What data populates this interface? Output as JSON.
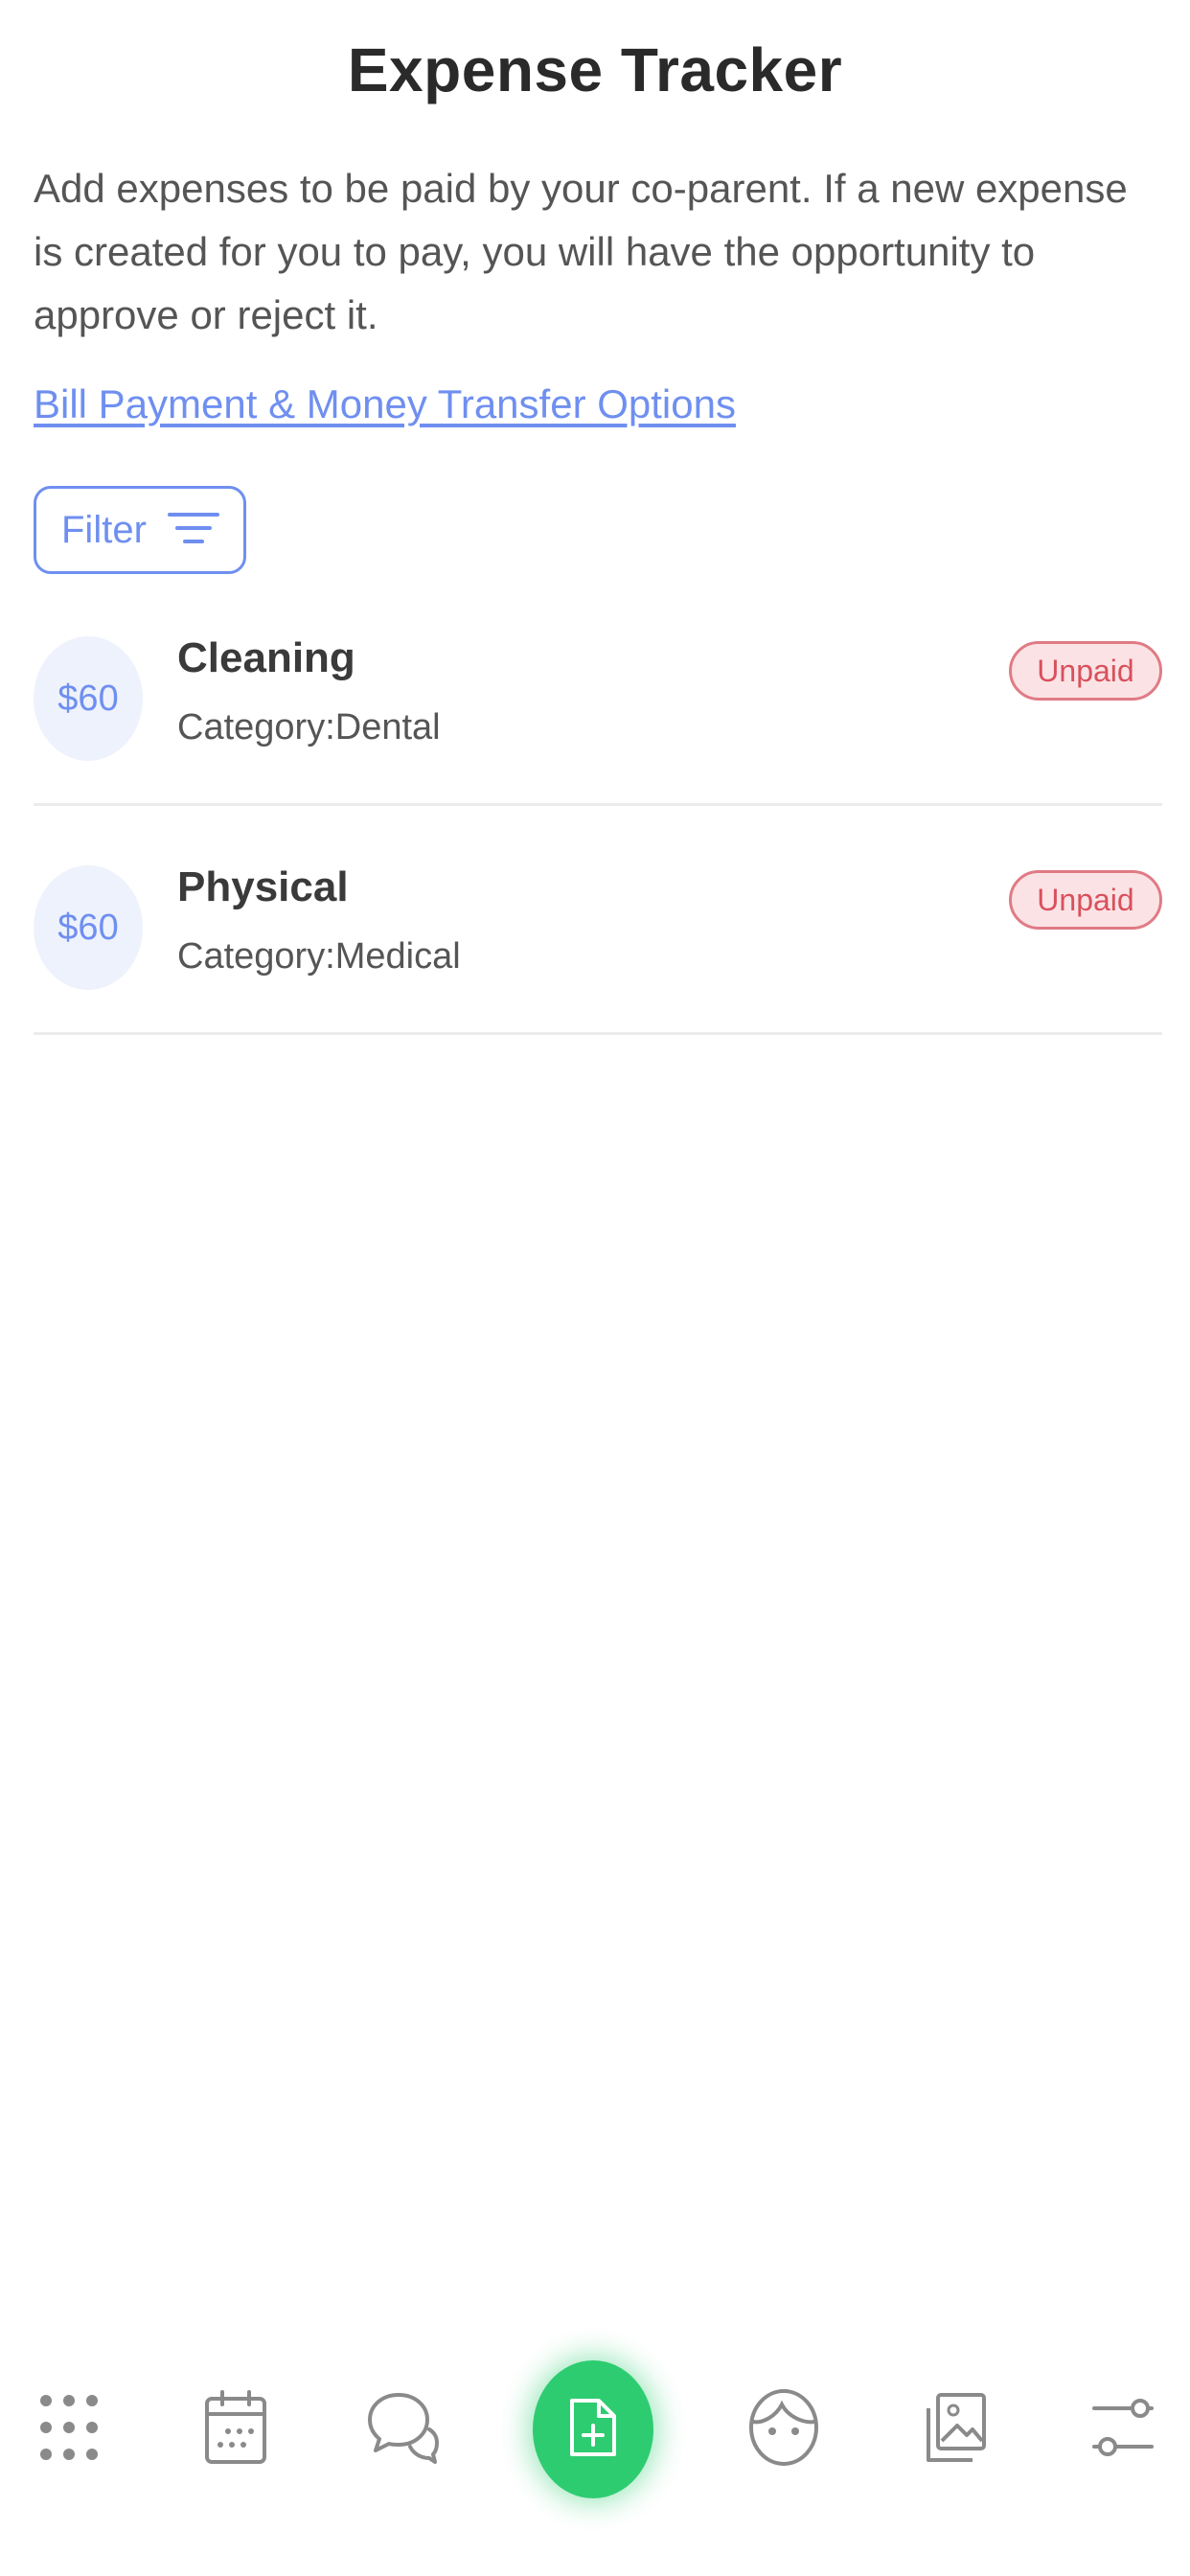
{
  "header": {
    "title": "Expense Tracker"
  },
  "intro": {
    "text": "Add expenses to be paid by your co-parent. If a new expense is created for you to pay, you will have the opportunity to approve or reject it."
  },
  "links": {
    "bill_payment": "Bill Payment & Money Transfer Options"
  },
  "filter": {
    "label": "Filter",
    "icon": "filter-lines-icon"
  },
  "expenses": [
    {
      "amount": "$60",
      "title": "Cleaning",
      "category": "Category:Dental",
      "status": "Unpaid"
    },
    {
      "amount": "$60",
      "title": "Physical",
      "category": "Category:Medical",
      "status": "Unpaid"
    }
  ],
  "bottom_nav": {
    "items": [
      {
        "icon": "dots-grid-icon",
        "active": false
      },
      {
        "icon": "calendar-icon",
        "active": false
      },
      {
        "icon": "chat-bubbles-icon",
        "active": false
      },
      {
        "icon": "add-document-icon",
        "active": true
      },
      {
        "icon": "child-face-icon",
        "active": false
      },
      {
        "icon": "photos-icon",
        "active": false
      },
      {
        "icon": "sliders-icon",
        "active": false
      }
    ]
  },
  "colors": {
    "accent": "#6f8ff0",
    "fab": "#2ecc71",
    "unpaid_text": "#d9505d",
    "unpaid_bg": "#fbe3e5",
    "amount_bg": "#eef2fc",
    "nav_icon": "#8a8a8a"
  }
}
